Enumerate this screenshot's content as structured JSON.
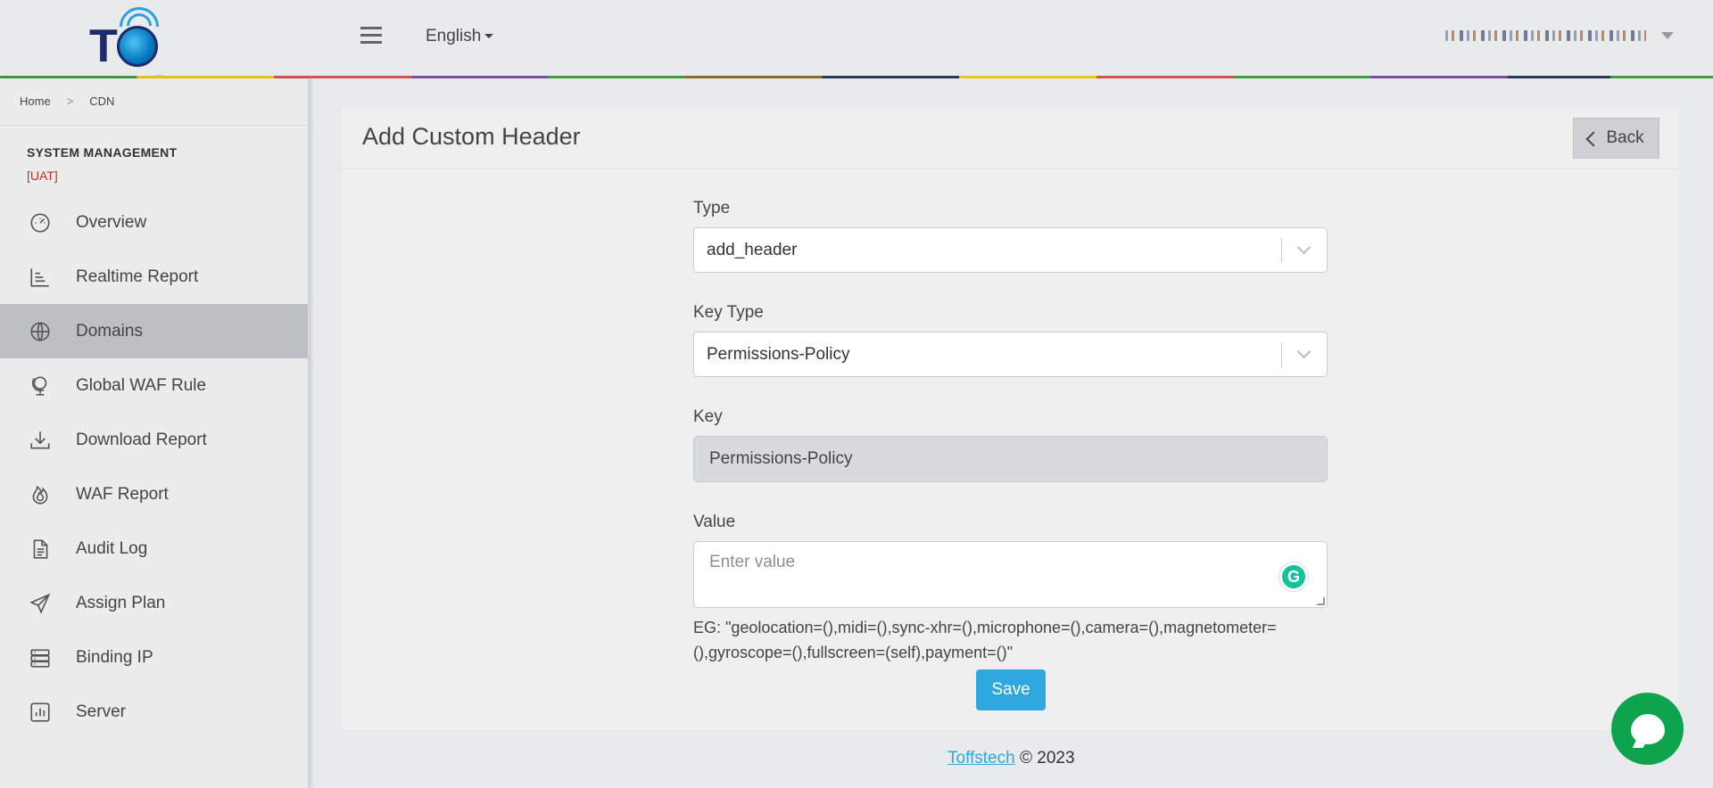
{
  "header": {
    "logo_text": "TOFFS",
    "language": "English",
    "user_name": ""
  },
  "breadcrumb": [
    "Home",
    "CDN"
  ],
  "sidebar": {
    "title": "SYSTEM MANAGEMENT",
    "env": "[UAT]",
    "items": [
      {
        "label": "Overview",
        "icon": "dashboard-gauge-icon"
      },
      {
        "label": "Realtime Report",
        "icon": "bar-chart-icon"
      },
      {
        "label": "Domains",
        "icon": "globe-icon",
        "active": true
      },
      {
        "label": "Global WAF Rule",
        "icon": "globe-stand-icon"
      },
      {
        "label": "Download Report",
        "icon": "download-icon"
      },
      {
        "label": "WAF Report",
        "icon": "fire-icon"
      },
      {
        "label": "Audit Log",
        "icon": "document-icon"
      },
      {
        "label": "Assign Plan",
        "icon": "send-icon"
      },
      {
        "label": "Binding IP",
        "icon": "server-rack-icon"
      },
      {
        "label": "Server",
        "icon": "chart-square-icon"
      }
    ]
  },
  "card": {
    "title": "Add Custom Header",
    "back_label": "Back"
  },
  "form": {
    "type_label": "Type",
    "type_value": "add_header",
    "key_type_label": "Key Type",
    "key_type_value": "Permissions-Policy",
    "key_label": "Key",
    "key_value": "Permissions-Policy",
    "value_label": "Value",
    "value_placeholder": "Enter value",
    "hint_line1": "EG: \"geolocation=(),midi=(),sync-xhr=(),microphone=(),camera=(),magnetometer=",
    "hint_line2": "(),gyroscope=(),fullscreen=(self),payment=()\"",
    "save_label": "Save"
  },
  "footer": {
    "link": "Toffstech",
    "text": "© 2023"
  },
  "colors": {
    "accent": "#2ea8df",
    "active_menu": "#bdc0c3",
    "env_tag": "#d7261b",
    "chat": "#0ea44e"
  }
}
